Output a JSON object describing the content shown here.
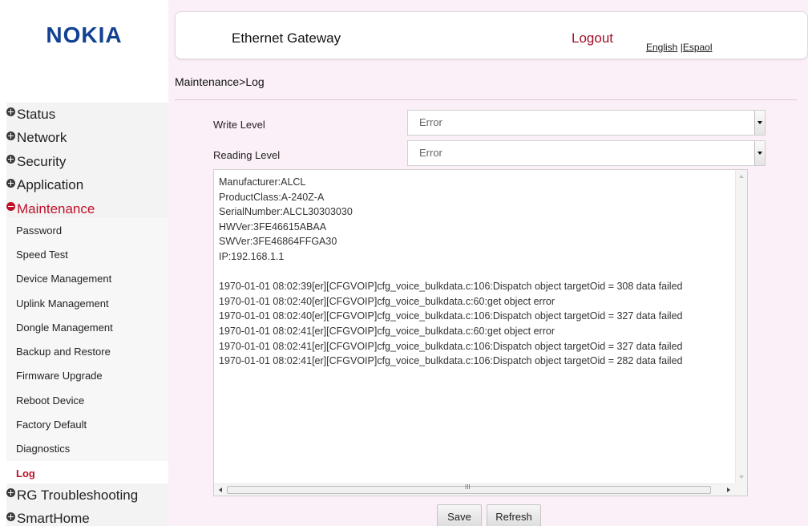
{
  "brand": {
    "logo": "NOKIA"
  },
  "header": {
    "title": "Ethernet Gateway",
    "logout": "Logout",
    "lang_english": "English",
    "lang_sep": " |",
    "lang_espanol": "Espaol"
  },
  "breadcrumb": "Maintenance>Log",
  "nav": {
    "status": "Status",
    "network": "Network",
    "security": "Security",
    "application": "Application",
    "maintenance": "Maintenance",
    "rg_troubleshooting": "RG Troubleshooting",
    "smarthome": "SmartHome"
  },
  "subnav": [
    "Password",
    "Speed Test",
    "Device Management",
    "Uplink Management",
    "Dongle Management",
    "Backup and Restore",
    "Firmware Upgrade",
    "Reboot Device",
    "Factory Default",
    "Diagnostics",
    "Log"
  ],
  "form": {
    "write_level_label": "Write Level",
    "write_level_value": "Error",
    "reading_level_label": "Reading Level",
    "reading_level_value": "Error"
  },
  "log_lines": [
    "Manufacturer:ALCL",
    "ProductClass:A-240Z-A",
    "SerialNumber:ALCL30303030",
    "HWVer:3FE46615ABAA",
    "SWVer:3FE46864FFGA30",
    "IP:192.168.1.1",
    "",
    "1970-01-01 08:02:39[er][CFGVOIP]cfg_voice_bulkdata.c:106:Dispatch object targetOid = 308 data failed",
    "1970-01-01 08:02:40[er][CFGVOIP]cfg_voice_bulkdata.c:60:get object error",
    "1970-01-01 08:02:40[er][CFGVOIP]cfg_voice_bulkdata.c:106:Dispatch object targetOid = 327 data failed",
    "1970-01-01 08:02:41[er][CFGVOIP]cfg_voice_bulkdata.c:60:get object error",
    "1970-01-01 08:02:41[er][CFGVOIP]cfg_voice_bulkdata.c:106:Dispatch object targetOid = 327 data failed",
    "1970-01-01 08:02:41[er][CFGVOIP]cfg_voice_bulkdata.c:106:Dispatch object targetOid = 282 data failed"
  ],
  "scroll_grip": "III",
  "buttons": {
    "save": "Save",
    "refresh": "Refresh"
  },
  "colors": {
    "brand_blue": "#124191",
    "active_red": "#c0102a",
    "main_bg": "#fbeff8"
  }
}
